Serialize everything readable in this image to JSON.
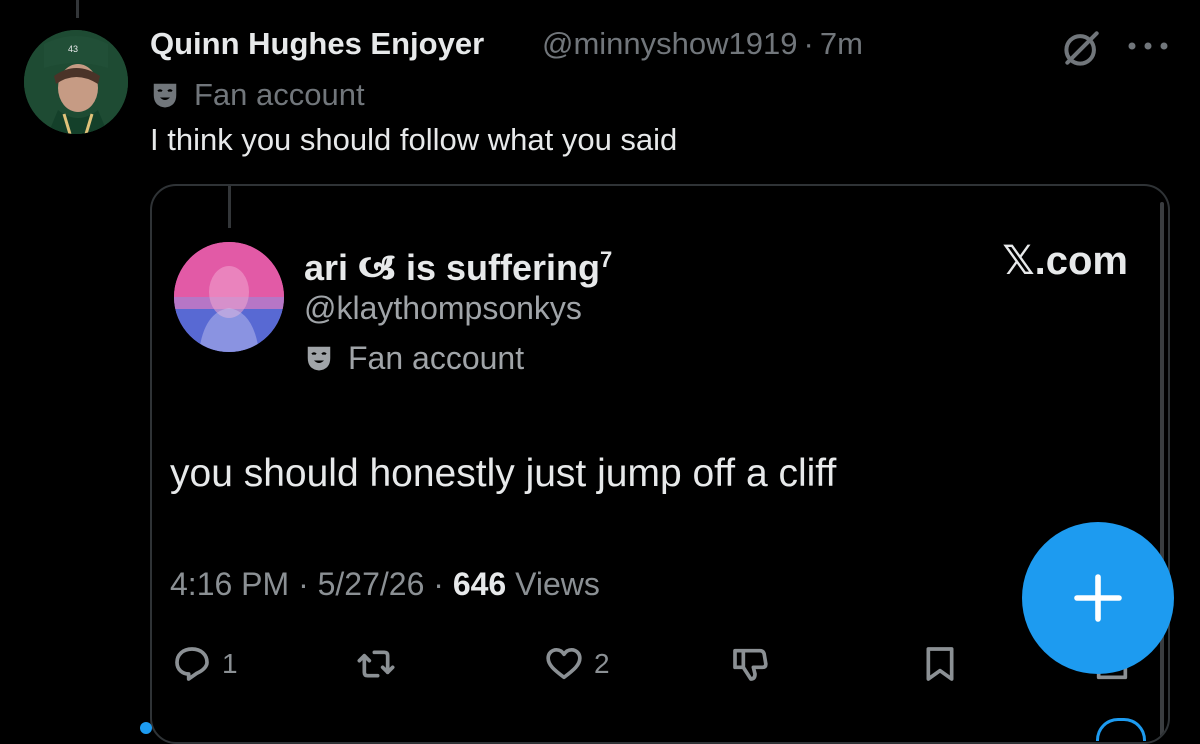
{
  "reply": {
    "display_name": "Quinn Hughes Enjoyer",
    "handle": "@minnyshow1919",
    "separator": "·",
    "time": "7m",
    "label_icon": "theater-mask-icon",
    "label": "Fan account",
    "text": "I think you should follow what you said"
  },
  "quote": {
    "display_name": "ari 🙦 is suffering",
    "superscript": "7",
    "handle": "@klaythompsonkys",
    "label": "Fan account",
    "source": "𝕏.com",
    "text": "you should honestly just jump off a cliff",
    "time": "4:16 PM",
    "date": "5/27/26",
    "views_count": "646",
    "views_label": "Views",
    "actions": {
      "replies": "1",
      "retweets": "",
      "likes": "2"
    }
  },
  "colors": {
    "background": "#000000",
    "primary_text": "#e7e9ea",
    "secondary_text": "#71767b",
    "accent": "#1d9bf0"
  }
}
